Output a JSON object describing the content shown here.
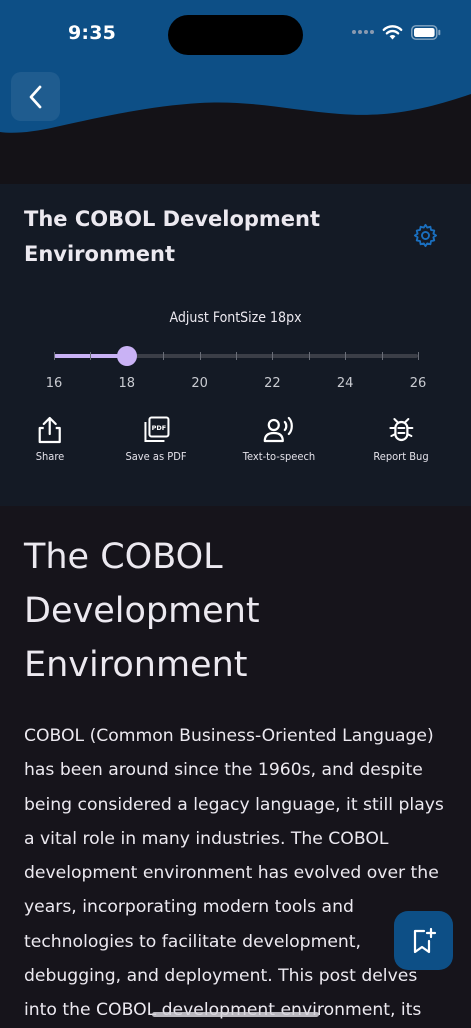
{
  "status_bar": {
    "time": "9:35"
  },
  "colors": {
    "header_wave": "#0d4f86",
    "accent": "#c9b2f5",
    "panel": "#141a25",
    "background": "#16141b",
    "icon_blue": "#1a6fbf"
  },
  "panel": {
    "title": "The COBOL Development Environment",
    "font_label": "Adjust FontSize 18px",
    "slider": {
      "min": 16,
      "max": 26,
      "value": 18,
      "labels": [
        "16",
        "18",
        "20",
        "22",
        "24",
        "26"
      ]
    },
    "actions": [
      {
        "label": "Share",
        "icon": "share-icon"
      },
      {
        "label": "Save as PDF",
        "icon": "pdf-icon"
      },
      {
        "label": "Text-to-speech",
        "icon": "speaker-icon"
      },
      {
        "label": "Report Bug",
        "icon": "bug-icon"
      }
    ]
  },
  "article": {
    "title": "The COBOL Development Environment",
    "body": "COBOL (Common Business-Oriented Language) has been around since the 1960s, and despite being considered a legacy language, it still plays a vital role in many industries. The COBOL development environment has evolved over the years, incorporating modern tools and technologies to facilitate development, debugging, and deployment. This post delves into the COBOL development environment, its"
  }
}
